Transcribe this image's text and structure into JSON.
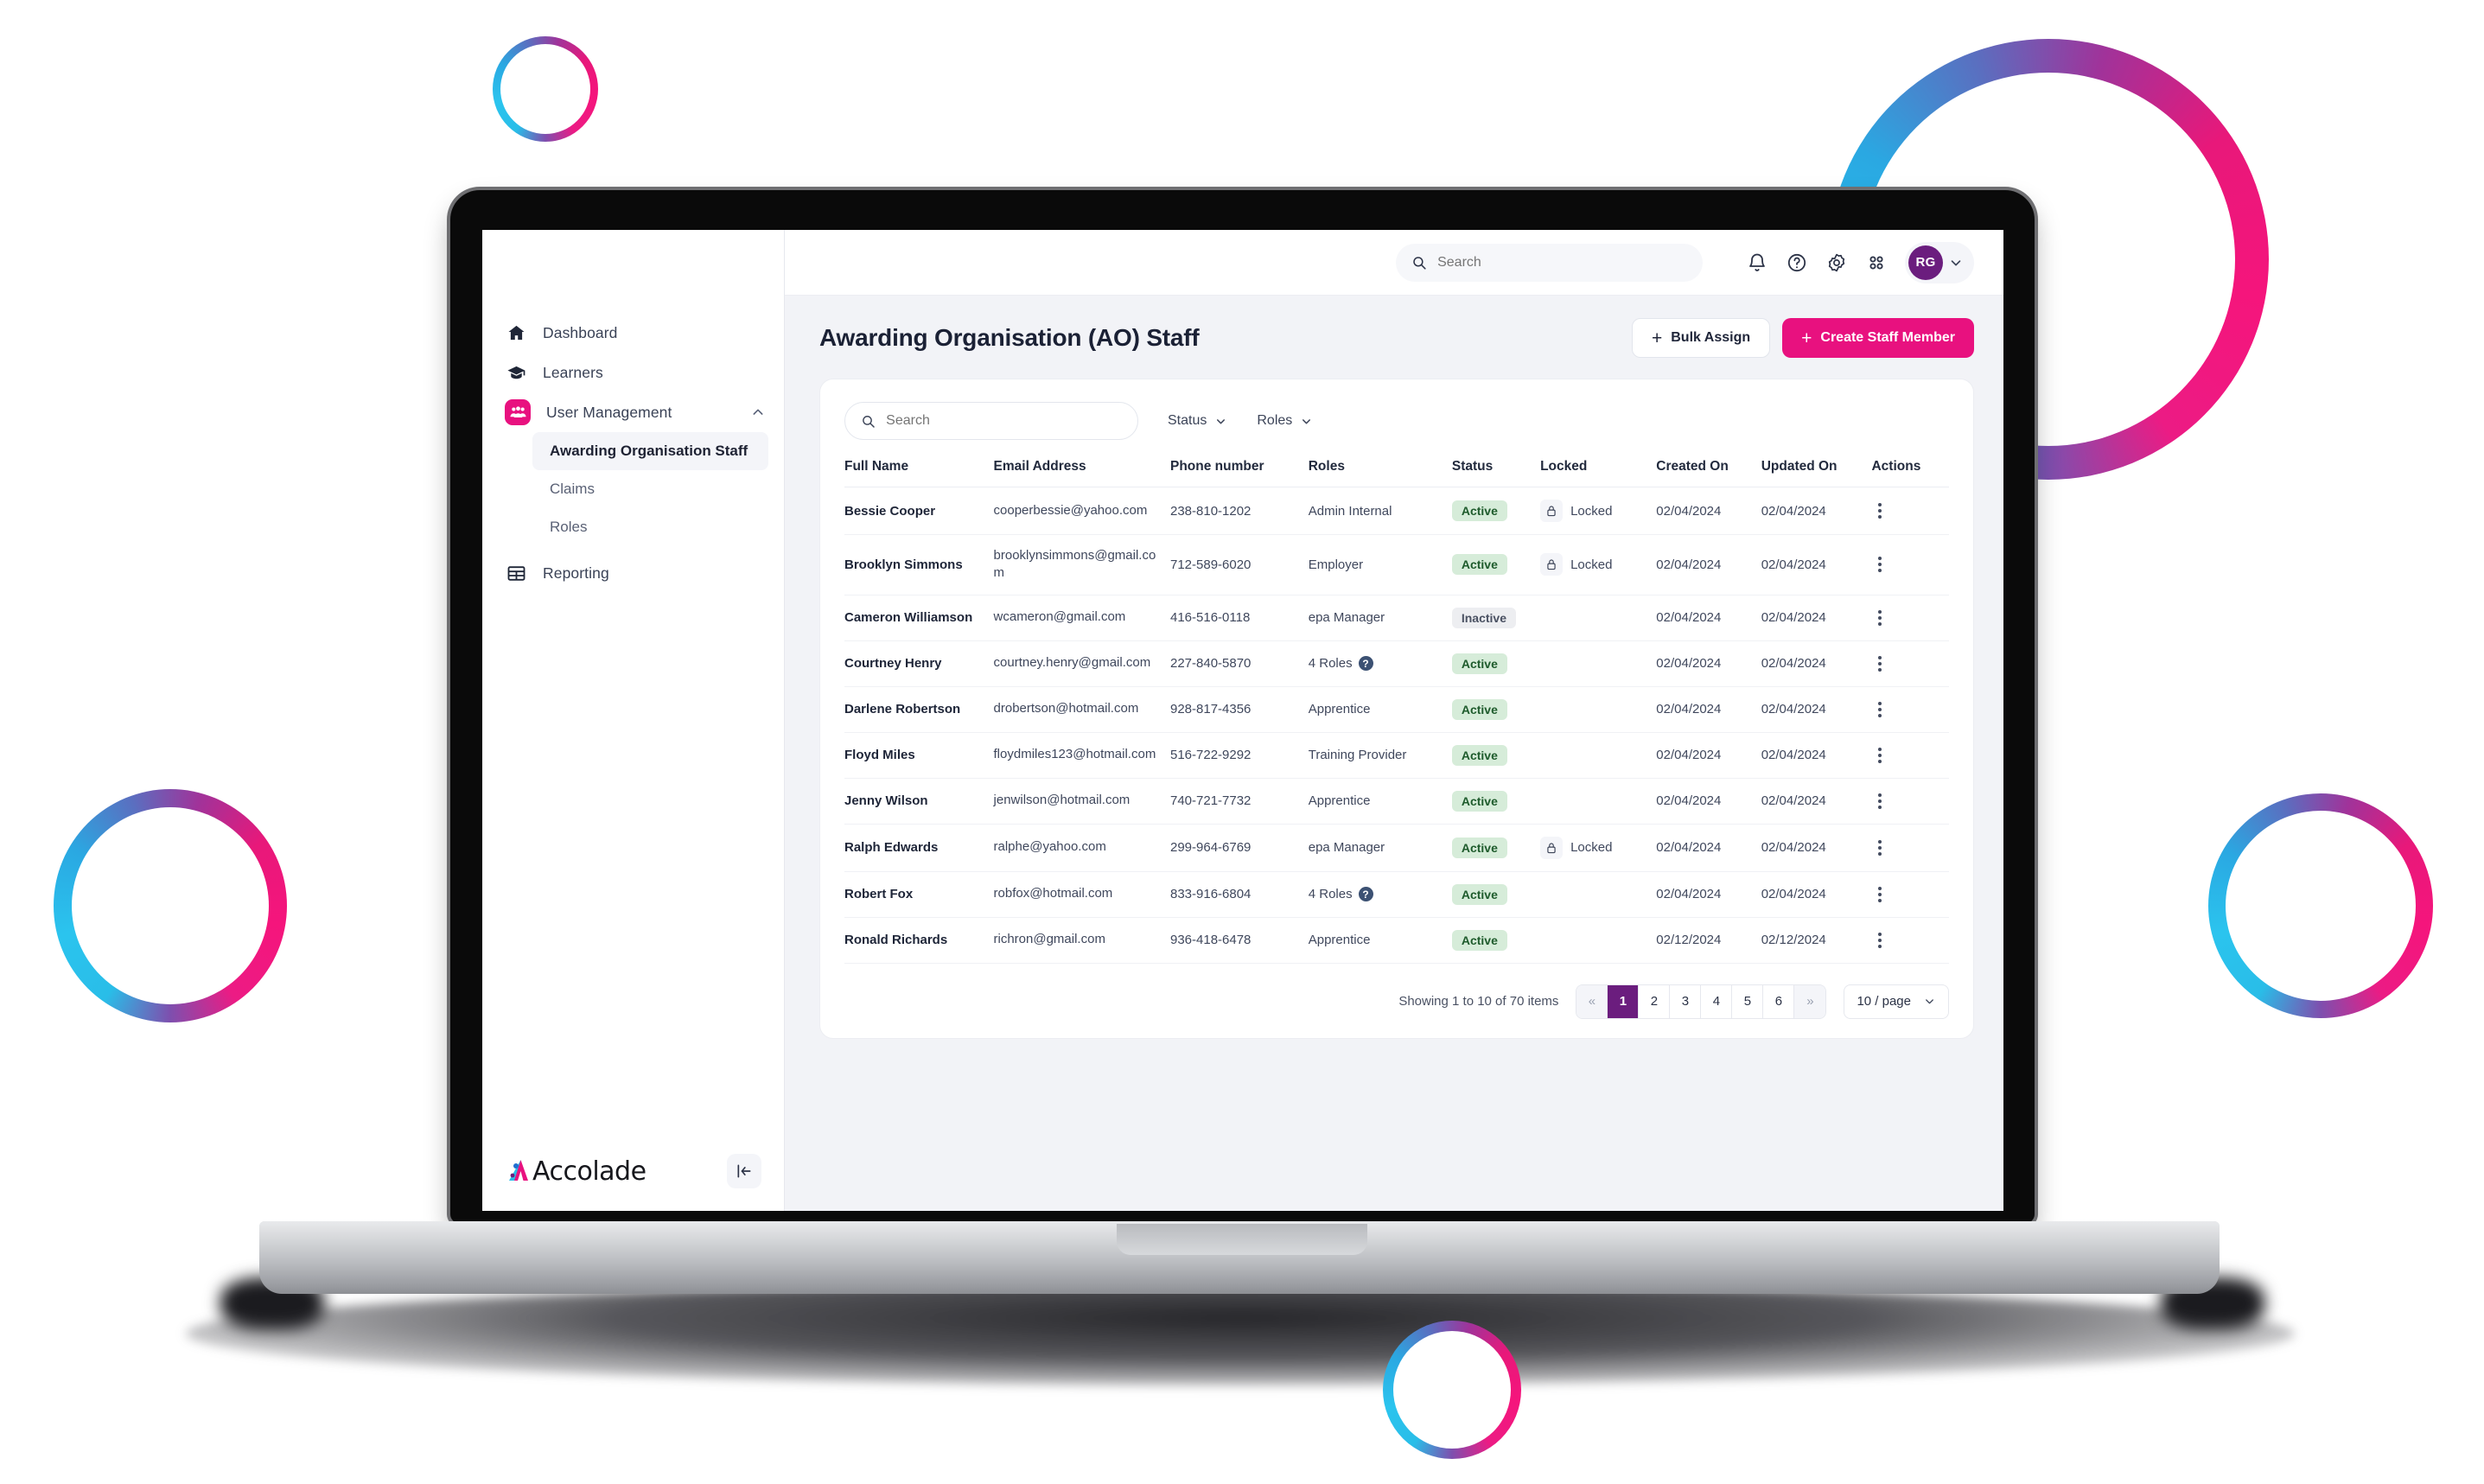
{
  "topbar": {
    "search_placeholder": "Search",
    "icons": [
      "bell-icon",
      "help-icon",
      "settings-icon",
      "apps-grid-icon"
    ],
    "avatar_initials": "RG"
  },
  "sidebar": {
    "items": [
      {
        "label": "Dashboard",
        "icon": "home-icon"
      },
      {
        "label": "Learners",
        "icon": "graduation-cap-icon"
      },
      {
        "label": "User Management",
        "icon": "users-icon",
        "expanded": true
      },
      {
        "label": "Reporting",
        "icon": "table-grid-icon"
      }
    ],
    "sub_items": [
      {
        "label": "Awarding Organisation Staff",
        "active": true
      },
      {
        "label": "Claims",
        "active": false
      },
      {
        "label": "Roles",
        "active": false
      }
    ],
    "logo_text": "Accolade",
    "collapse_icon": "collapse-left-icon"
  },
  "page": {
    "title": "Awarding Organisation (AO) Staff",
    "bulk_assign_label": "Bulk Assign",
    "create_label": "Create Staff Member"
  },
  "filters": {
    "search_placeholder": "Search",
    "status_label": "Status",
    "roles_label": "Roles"
  },
  "table": {
    "columns": [
      "Full Name",
      "Email Address",
      "Phone number",
      "Roles",
      "Status",
      "Locked",
      "Created On",
      "Updated On",
      "Actions"
    ],
    "rows": [
      {
        "name": "Bessie Cooper",
        "email": "cooperbessie@yahoo.com",
        "phone": "238-810-1202",
        "roles": "Admin Internal",
        "roles_multi": false,
        "status": "Active",
        "locked": "Locked",
        "created": "02/04/2024",
        "updated": "02/04/2024"
      },
      {
        "name": "Brooklyn Simmons",
        "email": "brooklynsimmons@gmail.com",
        "phone": "712-589-6020",
        "roles": "Employer",
        "roles_multi": false,
        "status": "Active",
        "locked": "Locked",
        "created": "02/04/2024",
        "updated": "02/04/2024"
      },
      {
        "name": "Cameron Williamson",
        "email": "wcameron@gmail.com",
        "phone": "416-516-0118",
        "roles": "epa Manager",
        "roles_multi": false,
        "status": "Inactive",
        "locked": "",
        "created": "02/04/2024",
        "updated": "02/04/2024"
      },
      {
        "name": "Courtney Henry",
        "email": "courtney.henry@gmail.com",
        "phone": "227-840-5870",
        "roles": "4 Roles",
        "roles_multi": true,
        "status": "Active",
        "locked": "",
        "created": "02/04/2024",
        "updated": "02/04/2024"
      },
      {
        "name": "Darlene Robertson",
        "email": "drobertson@hotmail.com",
        "phone": "928-817-4356",
        "roles": "Apprentice",
        "roles_multi": false,
        "status": "Active",
        "locked": "",
        "created": "02/04/2024",
        "updated": "02/04/2024"
      },
      {
        "name": "Floyd Miles",
        "email": "floydmiles123@hotmail.com",
        "phone": "516-722-9292",
        "roles": "Training Provider",
        "roles_multi": false,
        "status": "Active",
        "locked": "",
        "created": "02/04/2024",
        "updated": "02/04/2024"
      },
      {
        "name": "Jenny Wilson",
        "email": "jenwilson@hotmail.com",
        "phone": "740-721-7732",
        "roles": "Apprentice",
        "roles_multi": false,
        "status": "Active",
        "locked": "",
        "created": "02/04/2024",
        "updated": "02/04/2024"
      },
      {
        "name": "Ralph Edwards",
        "email": "ralphe@yahoo.com",
        "phone": "299-964-6769",
        "roles": "epa Manager",
        "roles_multi": false,
        "status": "Active",
        "locked": "Locked",
        "created": "02/04/2024",
        "updated": "02/04/2024"
      },
      {
        "name": "Robert Fox",
        "email": "robfox@hotmail.com",
        "phone": "833-916-6804",
        "roles": "4 Roles",
        "roles_multi": true,
        "status": "Active",
        "locked": "",
        "created": "02/04/2024",
        "updated": "02/04/2024"
      },
      {
        "name": "Ronald Richards",
        "email": "richron@gmail.com",
        "phone": "936-418-6478",
        "roles": "Apprentice",
        "roles_multi": false,
        "status": "Active",
        "locked": "",
        "created": "02/12/2024",
        "updated": "02/12/2024"
      }
    ]
  },
  "pagination": {
    "showing": "Showing 1 to 10 of 70 items",
    "prev": "«",
    "next": "»",
    "pages": [
      "1",
      "2",
      "3",
      "4",
      "5",
      "6"
    ],
    "current_page": "1",
    "per_page": "10 / page"
  },
  "colors": {
    "brand_pink": "#e8117f",
    "brand_purple": "#6b1d7e",
    "brand_cyan": "#29bde8",
    "status_active_bg": "#d6ecd9",
    "status_active_text": "#1e5b2c",
    "status_inactive_bg": "#edeef1"
  }
}
